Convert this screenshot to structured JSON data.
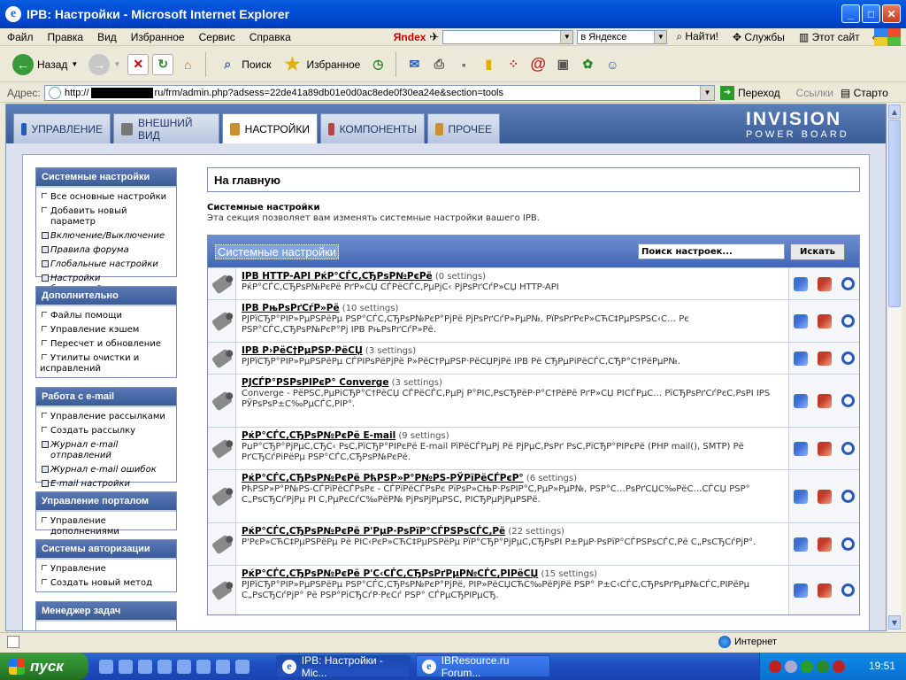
{
  "window": {
    "title": "IPB: Настройки - Microsoft Internet Explorer"
  },
  "menu": [
    "Файл",
    "Правка",
    "Вид",
    "Избранное",
    "Сервис",
    "Справка"
  ],
  "yandex": {
    "logo": "Яndex",
    "search_scope": "в Яндексе",
    "find": "Найти!",
    "services": "Службы",
    "this_site": "Этот сайт"
  },
  "toolbar": {
    "back": "Назад",
    "search": "Поиск",
    "favorites": "Избранное"
  },
  "address": {
    "label": "Адрес:",
    "prefix": "http://",
    "suffix": "ru/frm/admin.php?adsess=22de41a89db01e0d0ac8ede0f30ea24e&section=tools",
    "go": "Переход",
    "links": "Ссылки",
    "extra": "Старто"
  },
  "ipb": {
    "tabs": [
      "УПРАВЛЕНИЕ",
      "ВНЕШНИЙ ВИД",
      "НАСТРОЙКИ",
      "КОМПОНЕНТЫ",
      "ПРОЧЕЕ"
    ],
    "logo_line1": "INVISION",
    "logo_line2": "POWER BOARD"
  },
  "sidebar": [
    {
      "title": "Системные настройки",
      "items": [
        {
          "label": "Все основные настройки",
          "italic": false
        },
        {
          "label": "Добавить новый параметр",
          "italic": false
        },
        {
          "label": "Включение/Выключение",
          "italic": true
        },
        {
          "label": "Правила форума",
          "italic": true
        },
        {
          "label": "Глобальные настройки",
          "italic": true
        },
        {
          "label": "Настройки быстродействия",
          "italic": true
        }
      ]
    },
    {
      "title": "Дополнительно",
      "items": [
        {
          "label": "Файлы помощи",
          "italic": false
        },
        {
          "label": "Управление кэшем",
          "italic": false
        },
        {
          "label": "Пересчет и обновление",
          "italic": false
        },
        {
          "label": "Утилиты очистки и исправлений",
          "italic": false
        }
      ]
    },
    {
      "title": "Работа с e-mail",
      "items": [
        {
          "label": "Управление рассылками",
          "italic": false
        },
        {
          "label": "Создать рассылку",
          "italic": false
        },
        {
          "label": "Журнал e-mail отправлений",
          "italic": true
        },
        {
          "label": "Журнал e-mail ошибок",
          "italic": true
        },
        {
          "label": "E-mail настройки",
          "italic": true
        }
      ]
    },
    {
      "title": "Управление порталом",
      "items": [
        {
          "label": "Управление дополнениями",
          "italic": false
        }
      ]
    },
    {
      "title": "Системы авторизации",
      "items": [
        {
          "label": "Управление",
          "italic": false
        },
        {
          "label": "Создать новый метод",
          "italic": false
        }
      ]
    },
    {
      "title": "Менеджер задач",
      "items": []
    }
  ],
  "main": {
    "breadcrumb": "На главную",
    "section_title": "Системные настройки",
    "section_desc": "Эта секция позволяет вам изменять системные настройки вашего IPB.",
    "table_title": "Системные настройки",
    "search_placeholder": "Поиск настроек...",
    "search_button": "Искать",
    "rows": [
      {
        "title": "IPB HTTP-API РќР°СЃС‚СЂРѕР№РєРё",
        "count": "(0 settings)",
        "desc": "РќР°СЃС‚СЂРѕР№РєРё РґР»СЏ СЃРёСЃС‚РµРјС‹ РјРѕРґСѓР»СЏ HTTP-API"
      },
      {
        "title": "IPB РњРѕРґСѓР»Рё",
        "count": "(10 settings)",
        "desc": "РЈРїСЂР°РІР»РµРЅРёРµ РЅР°СЃС‚СЂРѕР№РєР°РјРё РјРѕРґСѓР»РµР№, РїРѕРґРєР»СЋС‡РµРЅРЅС‹С… Рє РЅР°СЃС‚СЂРѕР№РєР°Рј IPB РњРѕРґСѓР»Рё."
      },
      {
        "title": "IPB Р›РёС†РµРЅР·РёСЏ",
        "count": "(3 settings)",
        "desc": "РЈРїСЂР°РІР»РµРЅРёРµ СЃРІРѕРёРјРё Р»РёС†РµРЅР·РёСЏРјРё IPB Рё СЂРµРіРёСЃС‚СЂР°С†РёРµР№."
      },
      {
        "title": "РЈСЃР°РЅРѕРІРєР° Converge",
        "count": "(3 settings)",
        "desc": "Converge - РёРЅС‚РµРіСЂР°С†РёСЏ СЃРёСЃС‚РµРј Р°РІС‚РѕСЂРёР·Р°С†РёРё РґР»СЏ РІСЃРµС… РїСЂРѕРґСѓРєС‚РѕРІ IPS РЎРѕРѕР±С‰РµСЃС‚РІР°."
      },
      {
        "title": "РќР°СЃС‚СЂРѕР№РєРё E-mail",
        "count": "(9 settings)",
        "desc": "РџР°СЂР°РјРµС‚СЂС‹ РѕС‚РїСЂР°РІРєРё E-mail РїРёСЃРµРј Рё РјРµС‚РѕРґ РѕС‚РїСЂР°РІРєРё (PHP mail(), SMTP) Рё РґСЂСѓРіРёРµ РЅР°СЃС‚СЂРѕР№РєРё."
      },
      {
        "title": "РќР°СЃС‚СЂРѕР№РєРё РћРЅР»Р°Р№РЅ-РЎРїРёСЃРєР°",
        "count": "(6 settings)",
        "desc": "РћРЅР»Р°Р№РЅ-СЃРїРёСЃРѕРє - СЃРїРёСЃРѕРє РїРѕР»СЊР·РѕРІР°С‚РµР»РµР№, РЅР°С…РѕРґСЏС‰РёС…СЃСЏ РЅР° С„РѕСЂСѓРјРµ РІ С‚РµРєСѓС‰РёР№ РјРѕРјРµРЅС‚ РІСЂРµРјРµРЅРё."
      },
      {
        "title": "РќР°СЃС‚СЂРѕР№РєРё Р'РµР·РѕРїР°СЃРЅРѕСЃС‚Рё",
        "count": "(22 settings)",
        "desc": "Р'РєР»СЋС‡РµРЅРёРµ Рё РІС‹РєР»СЋС‡РµРЅРёРµ РїР°СЂР°РјРµС‚СЂРѕРІ Р±РµР·РѕРїР°СЃРЅРѕСЃС‚Рё С„РѕСЂСѓРјР°."
      },
      {
        "title": "РќР°СЃС‚СЂРѕР№РєРё Р'С‹СЃС‚СЂРѕРґРµР№СЃС‚РІРёСЏ",
        "count": "(15 settings)",
        "desc": "РЈРїСЂР°РІР»РµРЅРёРµ РЅР°СЃС‚СЂРѕР№РєР°РјРё, РІР»РёСЏСЋС‰РёРјРё РЅР° Р±С‹СЃС‚СЂРѕРґРµР№СЃС‚РІРёРµ С„РѕСЂСѓРјР° Рё РЅР°РіСЂСѓР·РєСѓ РЅР° СЃРµСЂРІРµСЂ."
      }
    ]
  },
  "status": {
    "zone": "Интернет"
  },
  "taskbar": {
    "start": "пуск",
    "tasks": [
      "IPB: Настройки - Mic...",
      "IBResource.ru Forum..."
    ],
    "clock": "19:51"
  }
}
